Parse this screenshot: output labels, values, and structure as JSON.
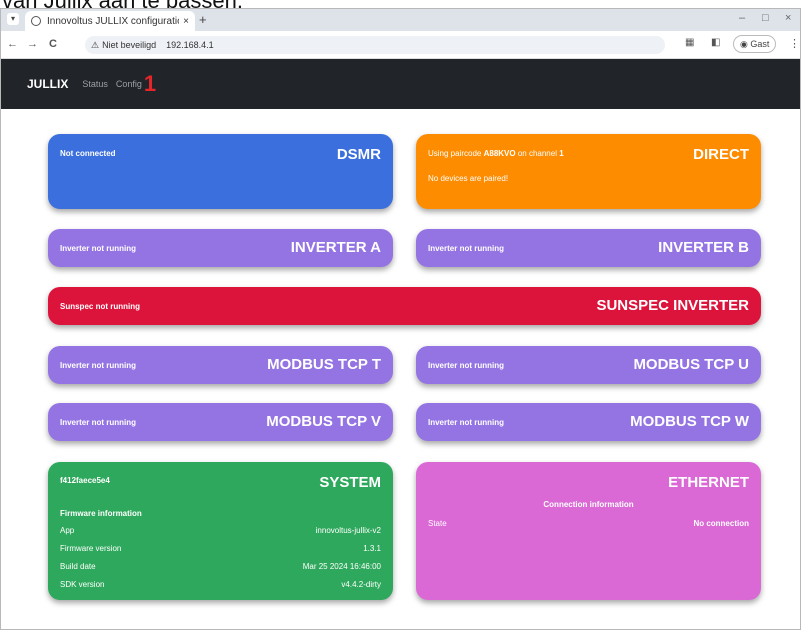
{
  "caption": "van Jullix aan te passen.",
  "browser": {
    "tab_title": "Innovoltus JULLIX configuration",
    "tab_close": "×",
    "new_tab": "+",
    "minimize": "–",
    "maximize": "□",
    "close": "×",
    "back": "←",
    "forward": "→",
    "reload": "C",
    "security_warning": "Niet beveiligd",
    "url": "192.168.4.1",
    "profile_label": "Gast",
    "menu": "⋮"
  },
  "app": {
    "brand": "JULLIX",
    "nav": [
      "Status",
      "Config"
    ],
    "annotation_mark": "1"
  },
  "cards": {
    "dsmr": {
      "title": "DSMR",
      "status": "Not connected"
    },
    "direct": {
      "title": "DIRECT",
      "pair_prefix": "Using paircode ",
      "paircode": "A88KVO",
      "pair_mid": " on channel ",
      "channel": "1",
      "devices": "No devices are paired!"
    },
    "inverter_a": {
      "title": "INVERTER A",
      "status": "Inverter not running"
    },
    "inverter_b": {
      "title": "INVERTER B",
      "status": "Inverter not running"
    },
    "sunspec": {
      "title": "SUNSPEC INVERTER",
      "status": "Sunspec not running"
    },
    "modbus_t": {
      "title": "MODBUS TCP T",
      "status": "Inverter not running"
    },
    "modbus_u": {
      "title": "MODBUS TCP U",
      "status": "Inverter not running"
    },
    "modbus_v": {
      "title": "MODBUS TCP V",
      "status": "Inverter not running"
    },
    "modbus_w": {
      "title": "MODBUS TCP W",
      "status": "Inverter not running"
    },
    "system": {
      "title": "SYSTEM",
      "id": "f412faece5e4",
      "fw_heading": "Firmware information",
      "rows": [
        {
          "label": "App",
          "value": "innovoltus-jullix-v2"
        },
        {
          "label": "Firmware version",
          "value": "1.3.1"
        },
        {
          "label": "Build date",
          "value": "Mar 25 2024 16:46:00"
        },
        {
          "label": "SDK version",
          "value": "v4.4.2-dirty"
        }
      ]
    },
    "ethernet": {
      "title": "ETHERNET",
      "conn_heading": "Connection information",
      "state_label": "State",
      "state_value": "No connection"
    }
  },
  "colors": {
    "navbar": "#212529",
    "dsmr": "#3b6fdd",
    "direct": "#fd8c00",
    "inverter": "#9474e3",
    "sunspec": "#dc143c",
    "system": "#2ea85c",
    "ethernet": "#da69d6",
    "annotation": "#e4262b"
  }
}
